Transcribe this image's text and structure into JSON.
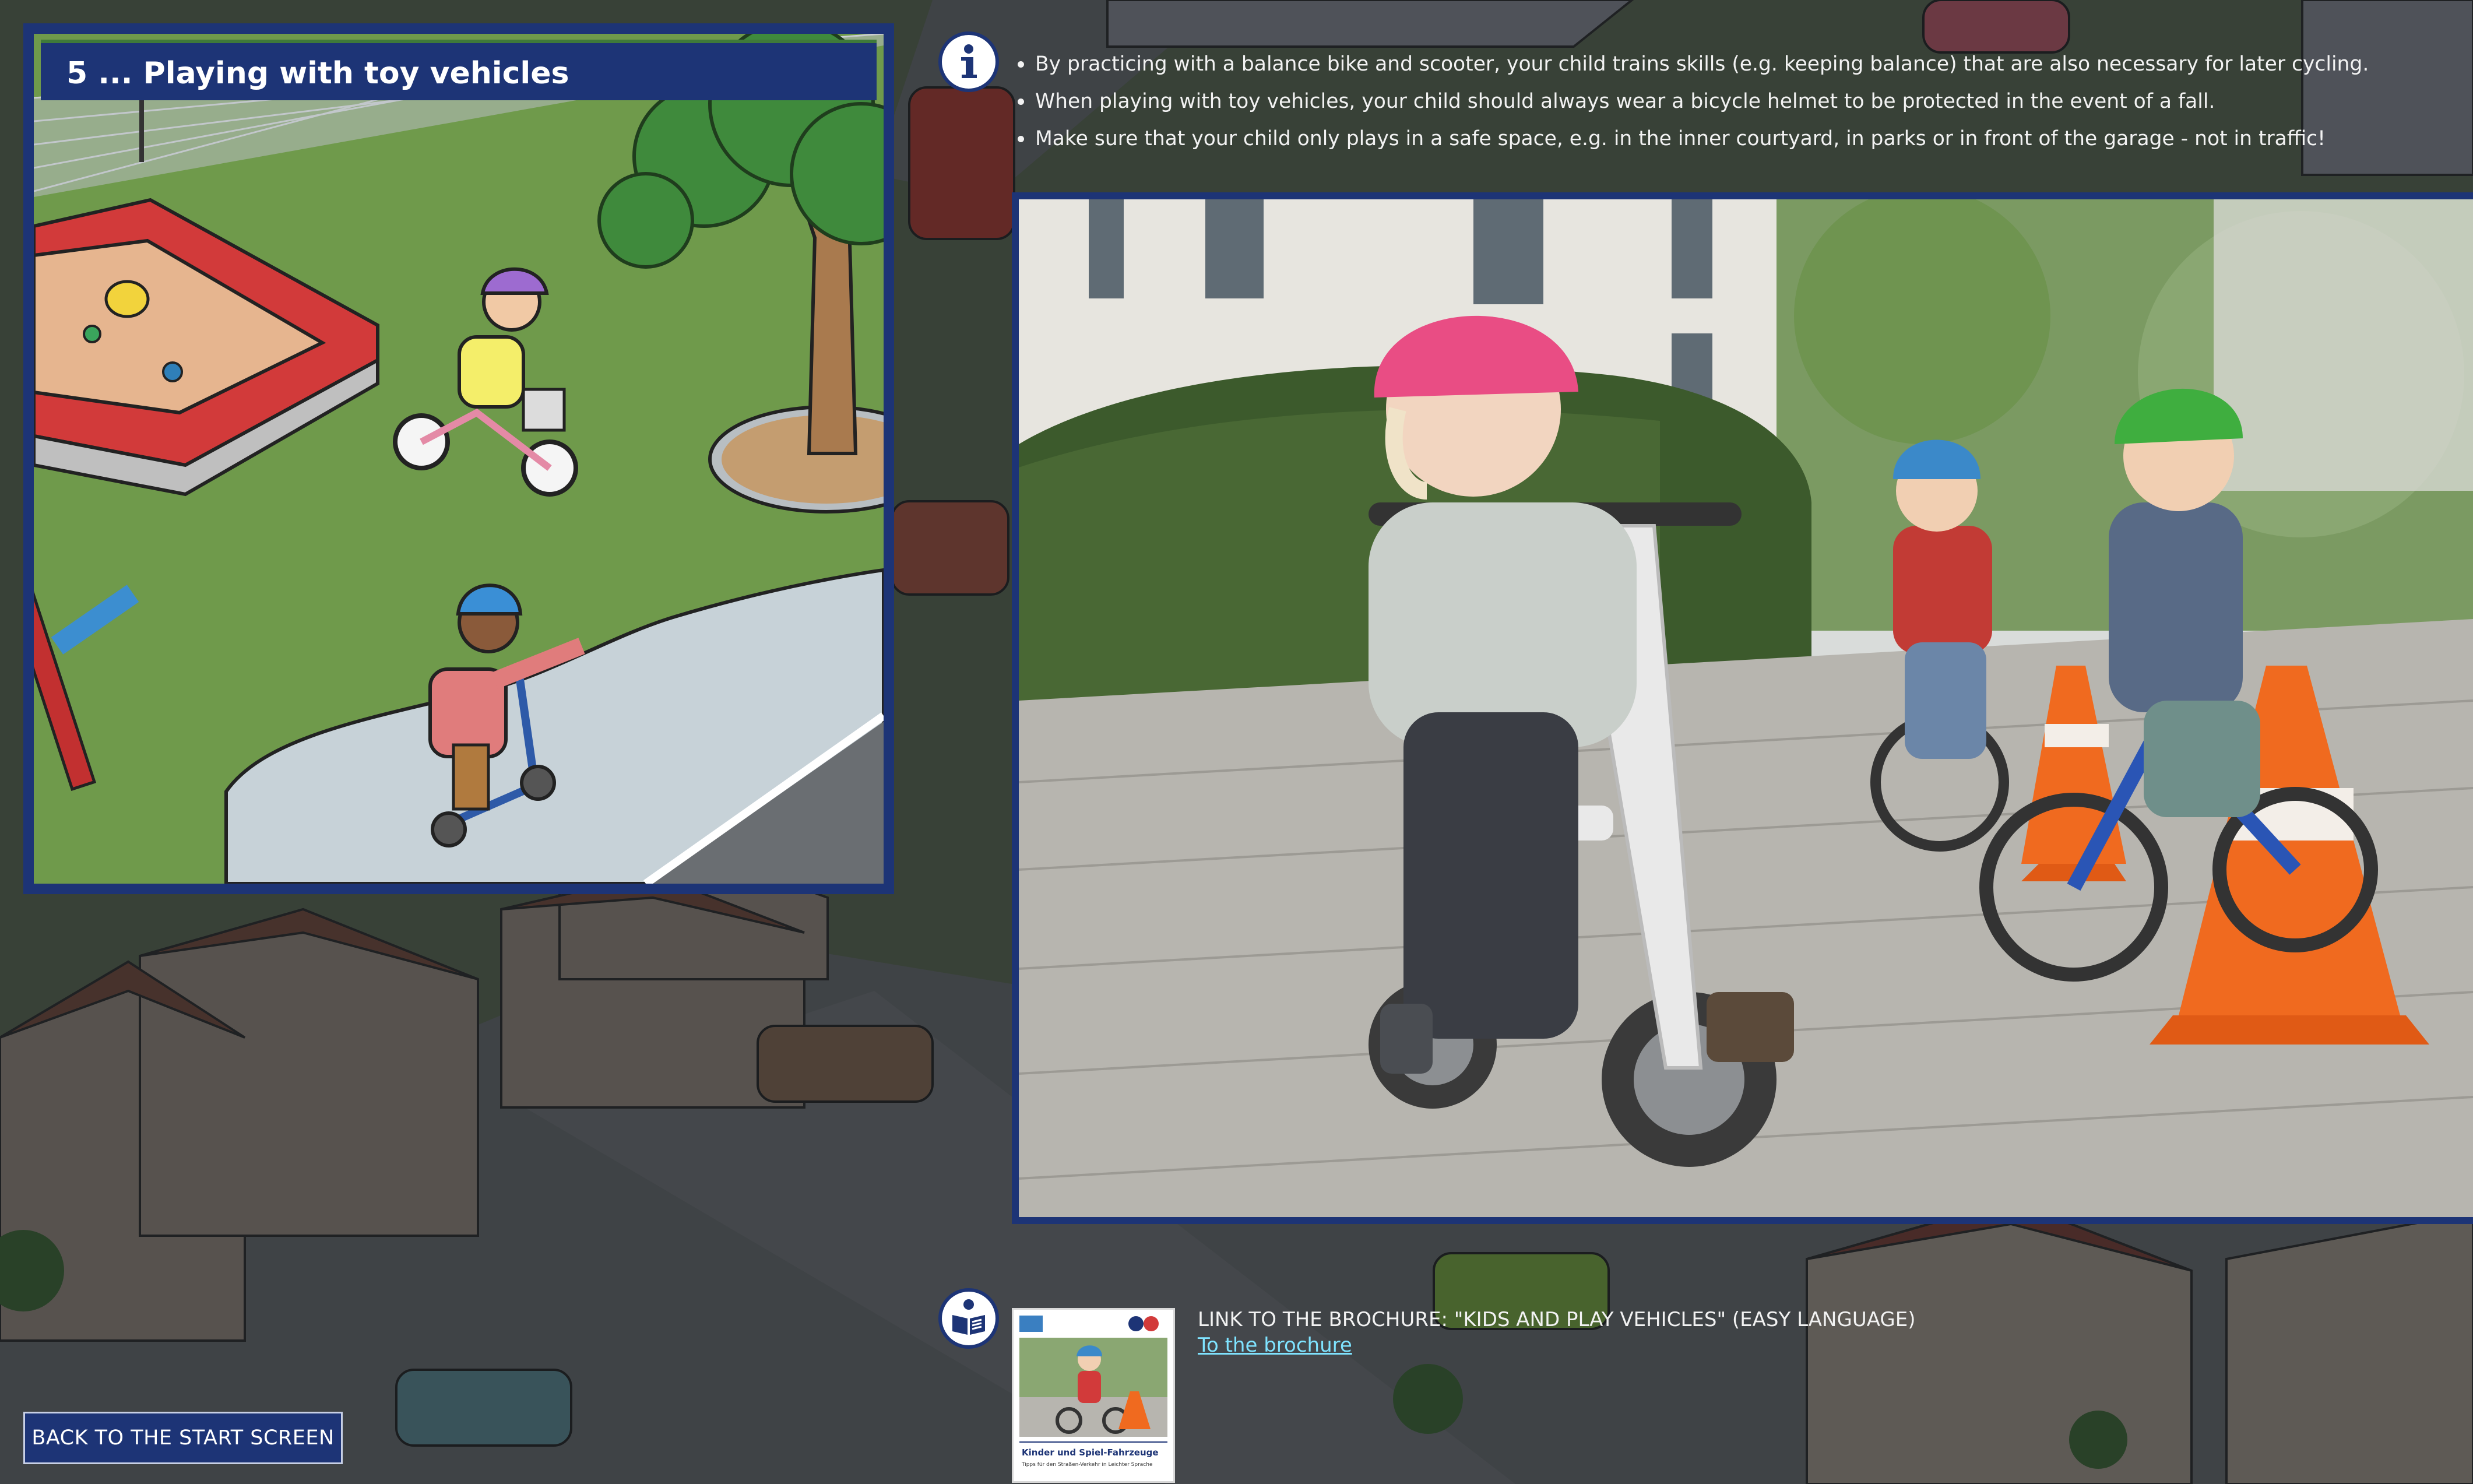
{
  "scene": {
    "title": "5 ... Playing with toy vehicles"
  },
  "info": {
    "icon": "info-icon",
    "bullets": [
      "By practicing with a balance bike and scooter, your child trains skills (e.g. keeping balance) that are also necessary for later cycling.",
      "When playing with toy vehicles, your child should always wear a bicycle helmet to be protected in the event of a fall.",
      "Make sure that your child only plays in a safe space, e.g. in the inner courtyard, in parks or in front of the garage - not in traffic!"
    ]
  },
  "brochure": {
    "icon": "brochure-book-icon",
    "heading": "LINK TO THE BROCHURE: \"KIDS AND PLAY VEHICLES\" (EASY LANGUAGE)",
    "link_label": "To the brochure",
    "thumb_title": "Kinder und Spiel-Fahrzeuge",
    "thumb_subtitle": "Tipps für den Straßen-Verkehr in Leichter Sprache"
  },
  "back_button": {
    "label": "BACK TO THE START SCREEN"
  },
  "colors": {
    "panel_blue": "#1d3476",
    "link_cyan": "#7fe3ff",
    "grass": "#6f9a4b"
  }
}
